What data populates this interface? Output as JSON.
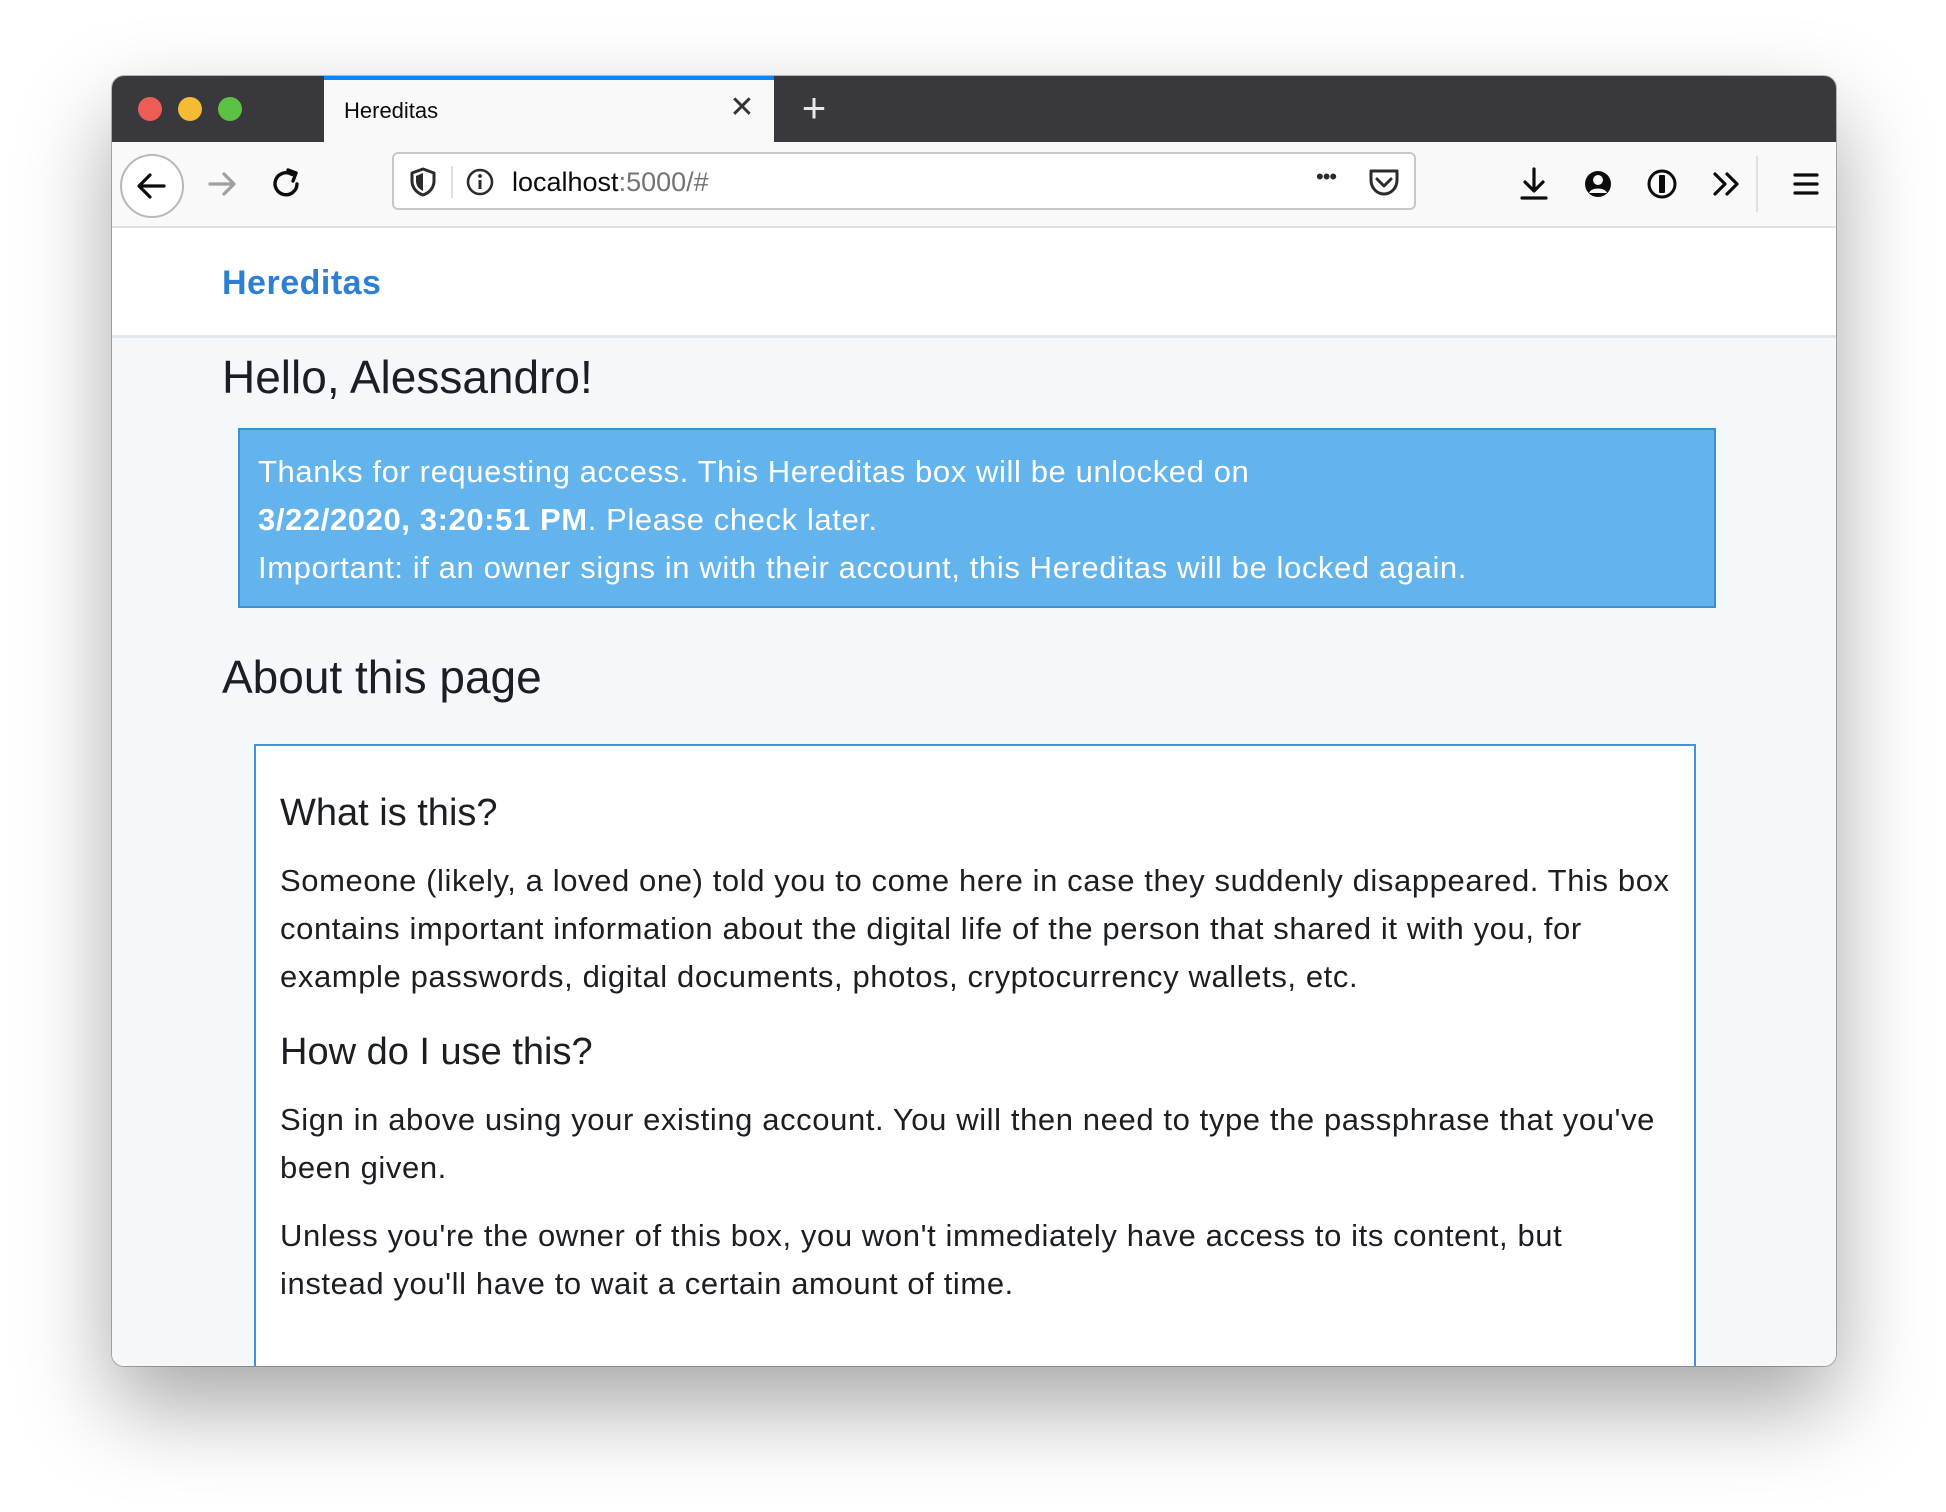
{
  "browser": {
    "tab_title": "Hereditas",
    "url_host": "localhost",
    "url_rest": ":5000/#",
    "close_glyph": "✕",
    "newtab_glyph": "+",
    "menu_dots": "•••",
    "icons": [
      "back-arrow-icon",
      "forward-arrow-icon",
      "reload-icon",
      "shield-icon",
      "info-icon",
      "page-actions-icon",
      "pocket-icon",
      "download-icon",
      "account-icon",
      "password-manager-icon",
      "overflow-icon",
      "hamburger-menu-icon"
    ]
  },
  "site": {
    "brand": "Hereditas",
    "greeting": "Hello, Alessandro!",
    "alert": {
      "text_1": "Thanks for requesting access. This Hereditas box will be unlocked on",
      "date_bold": "3/22/2020, 3:20:51 PM",
      "text_2": ". Please check later.",
      "text_3": "Important: if an owner signs in with their account, this Hereditas will be locked again."
    },
    "about_title": "About this page",
    "sections": [
      {
        "heading": "What is this?",
        "paragraphs": [
          "Someone (likely, a loved one) told you to come here in case they suddenly disappeared. This box contains important information about the digital life of the person that shared it with you, for example passwords, digital documents, photos, cryptocurrency wallets, etc."
        ]
      },
      {
        "heading": "How do I use this?",
        "paragraphs": [
          "Sign in above using your existing account. You will then need to type the passphrase that you've been given.",
          "Unless you're the owner of this box, you won't immediately have access to its content, but instead you'll have to wait a certain amount of time."
        ]
      }
    ]
  },
  "colors": {
    "brand": "#2d7fd3",
    "alert_bg": "#63b3ed",
    "card_border": "#3d93e0",
    "tab_accent": "#0a84ff"
  }
}
